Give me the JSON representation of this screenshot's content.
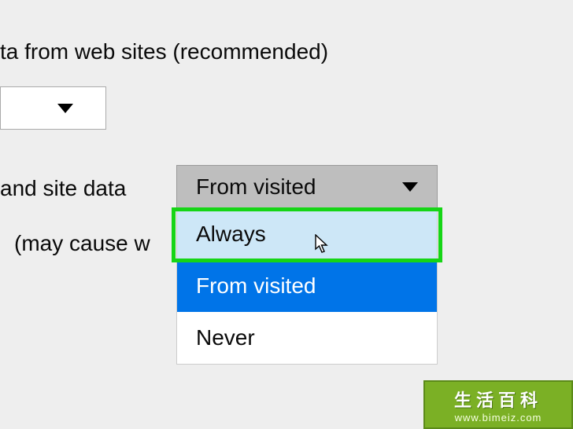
{
  "text": {
    "line1": "ta from web sites (recommended)",
    "line2": "and site data",
    "line3": "(may cause w"
  },
  "dropdown_small": {
    "selected": ""
  },
  "dropdown_main": {
    "selected": "From visited",
    "options": {
      "always": "Always",
      "from_visited": "From visited",
      "never": "Never"
    }
  },
  "watermark": {
    "top": "生活百科",
    "bottom": "www.bimeiz.com"
  }
}
